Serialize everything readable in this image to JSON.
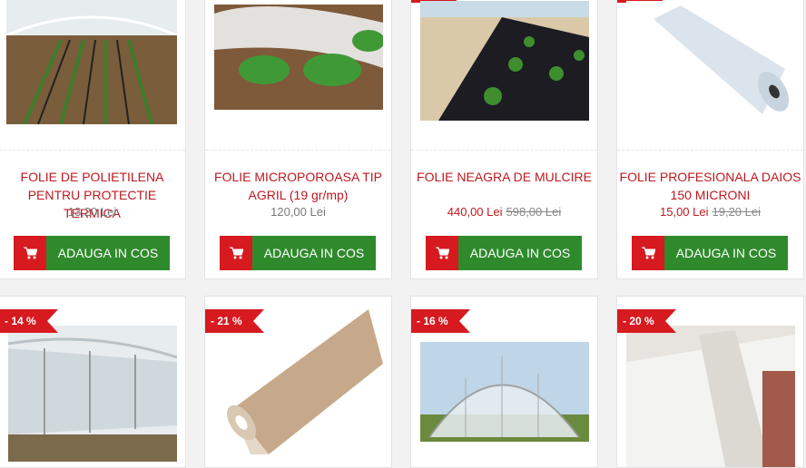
{
  "products": [
    {
      "title": "FOLIE DE POLIETILENA PENTRU PROTECTIE TERMICA",
      "price": "13,20 Lei",
      "old_price": "",
      "button": "ADAUGA IN COS"
    },
    {
      "title": "FOLIE MICROPOROASA TIP AGRIL (19 gr/mp)",
      "price": "120,00 Lei",
      "old_price": "",
      "button": "ADAUGA IN COS"
    },
    {
      "title": "FOLIE NEAGRA DE MULCIRE",
      "price": "440,00 Lei",
      "old_price": "598,00 Lei",
      "button": "ADAUGA IN COS"
    },
    {
      "title": "FOLIE PROFESIONALA DAIOS 150 MICRONI",
      "price": "15,00 Lei",
      "old_price": "19,20 Lei",
      "button": "ADAUGA IN COS"
    }
  ],
  "badges": [
    "- 14 %",
    "- 21 %",
    "- 16 %",
    "- 20 %"
  ],
  "colors": {
    "accent_red": "#d71920",
    "cart_green": "#2f8a2c",
    "title_red": "#c0181f"
  },
  "icons": {
    "cart": "cart-icon"
  }
}
